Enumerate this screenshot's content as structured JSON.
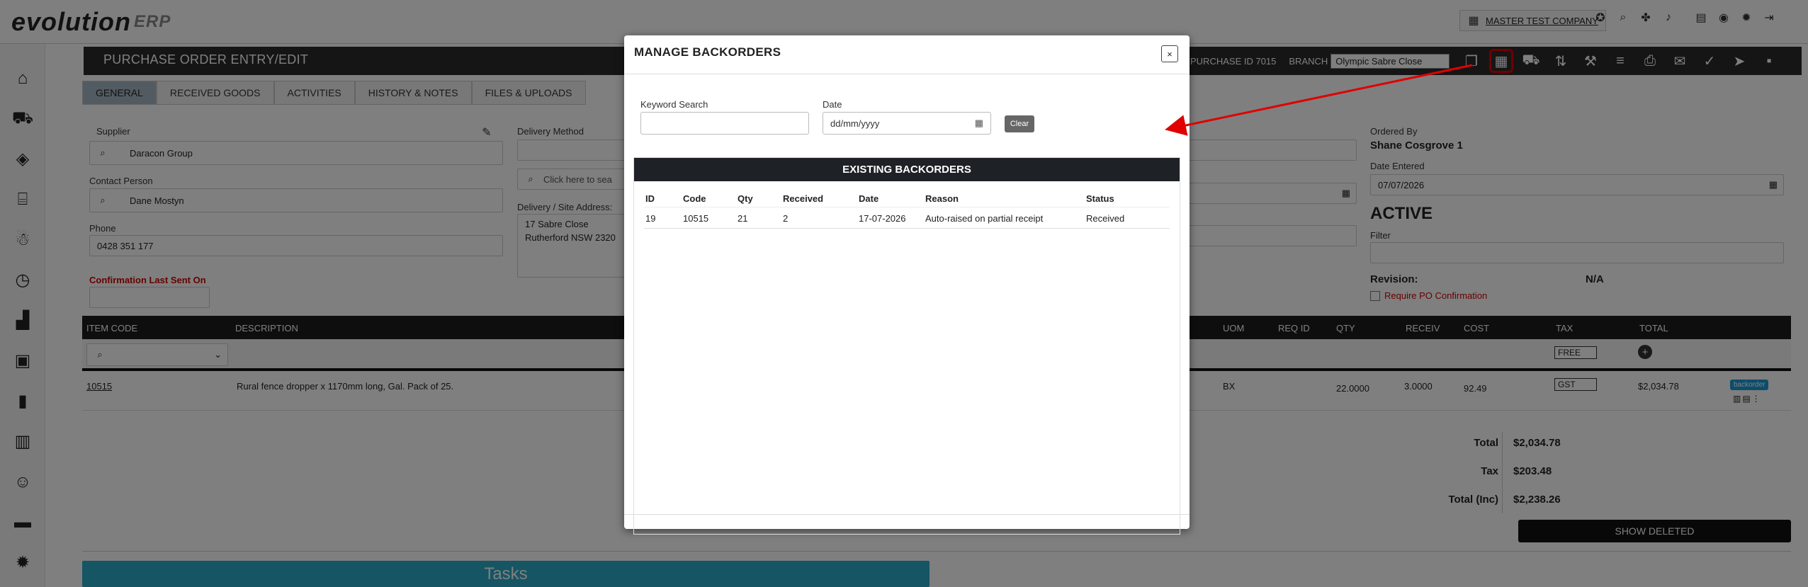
{
  "app": {
    "logo_main": "evolution",
    "logo_sub": "ERP"
  },
  "topbar": {
    "company": "MASTER TEST COMPANY"
  },
  "header": {
    "title": "PURCHASE ORDER ENTRY/EDIT",
    "purchase_id_label": "PURCHASE ID 7015",
    "branch_label": "BRANCH",
    "branch_value": "Olympic Sabre Close"
  },
  "tabs": [
    "GENERAL",
    "RECEIVED GOODS",
    "ACTIVITIES",
    "HISTORY & NOTES",
    "FILES & UPLOADS"
  ],
  "form": {
    "supplier_label": "Supplier",
    "supplier_value": "Daracon Group",
    "contact_label": "Contact Person",
    "contact_value": "Dane Mostyn",
    "phone_label": "Phone",
    "phone_value": "0428 351 177",
    "confirmation_label": "Confirmation Last Sent On",
    "delivery_method_label": "Delivery Method",
    "click_search": "Click here to sea",
    "delivery_address_label": "Delivery / Site Address:",
    "delivery_address_line1": "17 Sabre Close",
    "delivery_address_line2": "Rutherford NSW 2320",
    "ordered_by_label": "Ordered By",
    "ordered_by_value": "Shane Cosgrove 1",
    "date_entered_label": "Date Entered",
    "date_entered_value": "07/07/2026",
    "status": "ACTIVE",
    "filter_label": "Filter",
    "revision_label": "Revision:",
    "revision_value": "N/A",
    "require_po_label": "Require PO Confirmation"
  },
  "grid": {
    "headers": {
      "item_code": "ITEM CODE",
      "description": "DESCRIPTION",
      "uom": "UOM",
      "req_id": "REQ ID",
      "qty": "QTY",
      "receiv": "RECEIV",
      "cost": "COST",
      "tax": "TAX",
      "total": "TOTAL"
    },
    "filter_tax": "FREE",
    "row": {
      "item_code": "10515",
      "description": "Rural fence dropper x 1170mm long, Gal. Pack of 25.",
      "uom": "BX",
      "qty": "22.0000",
      "receiv": "3.0000",
      "cost": "92.49",
      "tax": "GST",
      "total": "$2,034.78",
      "badge": "backorder"
    }
  },
  "totals": {
    "total_label": "Total",
    "total_value": "$2,034.78",
    "tax_label": "Tax",
    "tax_value": "$203.48",
    "inc_label": "Total (Inc)",
    "inc_value": "$2,238.26",
    "show_deleted": "SHOW DELETED"
  },
  "tasks_label": "Tasks",
  "modal": {
    "title": "MANAGE BACKORDERS",
    "close": "×",
    "keyword_label": "Keyword Search",
    "keyword_value": "",
    "date_label": "Date",
    "date_placeholder": "dd/mm/yyyy",
    "clear": "Clear",
    "section_title": "EXISTING BACKORDERS",
    "columns": [
      "ID",
      "Code",
      "Qty",
      "Received",
      "Date",
      "Reason",
      "Status"
    ],
    "rows": [
      {
        "id": "19",
        "code": "10515",
        "qty": "21",
        "received": "2",
        "date": "17-07-2026",
        "reason": "Auto-raised on partial receipt",
        "status": "Received"
      }
    ]
  },
  "colors": {
    "accent_red": "#e00000",
    "header_dark": "#2b2b2b",
    "tasks_blue": "#2aaac8",
    "badge_blue": "#1a9ad6"
  }
}
